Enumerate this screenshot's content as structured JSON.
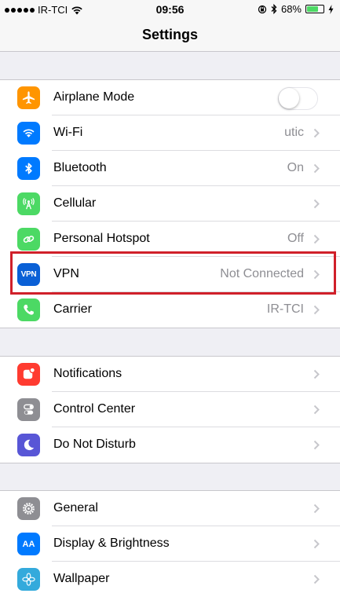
{
  "status_bar": {
    "carrier": "IR-TCI",
    "time": "09:56",
    "battery_percent": "68%",
    "battery_level": 0.68,
    "icons": [
      "signal-dots-icon",
      "wifi-icon",
      "orientation-lock-icon",
      "bluetooth-icon",
      "battery-icon",
      "charging-icon"
    ]
  },
  "nav": {
    "title": "Settings"
  },
  "groups": [
    {
      "rows": [
        {
          "label": "Airplane Mode",
          "value": "",
          "toggle_on": false,
          "icon": "airplane-icon",
          "icon_color": "#ff9500"
        },
        {
          "label": "Wi-Fi",
          "value": "utic",
          "icon": "wifi-icon",
          "icon_color": "#007aff"
        },
        {
          "label": "Bluetooth",
          "value": "On",
          "icon": "bluetooth-icon",
          "icon_color": "#007aff"
        },
        {
          "label": "Cellular",
          "value": "",
          "icon": "cellular-icon",
          "icon_color": "#4cd964"
        },
        {
          "label": "Personal Hotspot",
          "value": "Off",
          "icon": "hotspot-icon",
          "icon_color": "#4cd964"
        },
        {
          "label": "VPN",
          "value": "Not Connected",
          "icon": "vpn-icon",
          "icon_text": "VPN",
          "icon_color": "#0a60d6"
        },
        {
          "label": "Carrier",
          "value": "IR-TCI",
          "icon": "phone-icon",
          "icon_color": "#4cd964"
        }
      ]
    },
    {
      "rows": [
        {
          "label": "Notifications",
          "value": "",
          "icon": "notifications-icon",
          "icon_color": "#ff3b30"
        },
        {
          "label": "Control Center",
          "value": "",
          "icon": "control-center-icon",
          "icon_color": "#8e8e93"
        },
        {
          "label": "Do Not Disturb",
          "value": "",
          "icon": "moon-icon",
          "icon_color": "#5856d6"
        }
      ]
    },
    {
      "rows": [
        {
          "label": "General",
          "value": "",
          "icon": "gear-icon",
          "icon_color": "#8e8e93"
        },
        {
          "label": "Display & Brightness",
          "value": "",
          "icon": "display-icon",
          "icon_text": "AA",
          "icon_color": "#007aff"
        },
        {
          "label": "Wallpaper",
          "value": "",
          "icon": "wallpaper-icon",
          "icon_color": "#34aadc"
        }
      ]
    }
  ],
  "colors": {
    "highlight": "#d0202a",
    "background": "#efeff4",
    "value_gray": "#8e8e93"
  }
}
